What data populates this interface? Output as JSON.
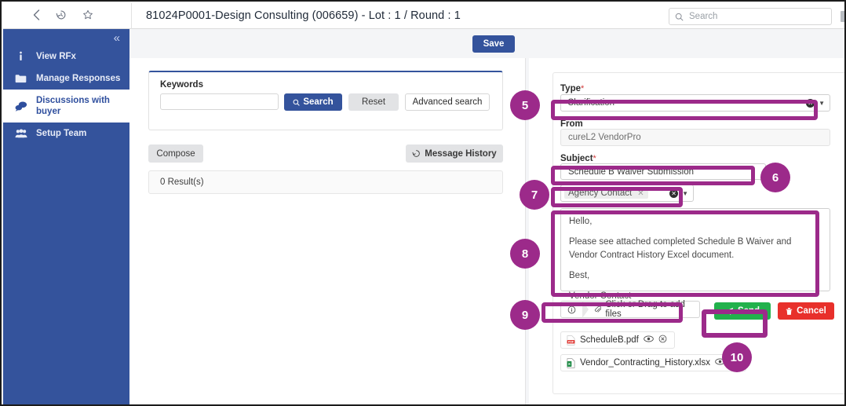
{
  "window": {
    "title": "81024P0001-Design Consulting (006659) - Lot : 1 / Round : 1",
    "nav": {
      "back": "‹",
      "history": "history-icon",
      "favorite": "star-icon"
    },
    "search": {
      "placeholder": "Search",
      "icon": "search-icon"
    }
  },
  "sidebar": {
    "collapse": "«",
    "items": [
      {
        "label": "View RFx",
        "icon": "info-icon",
        "active": false
      },
      {
        "label": "Manage Responses",
        "icon": "folder-icon",
        "active": false
      },
      {
        "label": "Discussions with buyer",
        "icon": "chat-bubbles-icon",
        "active": true
      },
      {
        "label": "Setup Team",
        "icon": "users-icon",
        "active": false
      }
    ]
  },
  "actionbar": {
    "save_label": "Save"
  },
  "search_panel": {
    "keywords_label": "Keywords",
    "keywords_value": "",
    "search_label": "Search",
    "reset_label": "Reset",
    "advanced_label": "Advanced search",
    "compose_label": "Compose",
    "message_history_label": "Message History",
    "results_label": "0 Result(s)"
  },
  "form": {
    "type_label": "Type",
    "type_required": "*",
    "type_value": "Clarification",
    "from_label": "From",
    "from_value": "cureL2 VendorPro",
    "subject_label": "Subject",
    "subject_required": "*",
    "subject_value": "Schedule B Waiver Submission",
    "recipient_chip": "Agency Contact",
    "recipient_remove": "✕",
    "body": [
      "Hello,",
      "Please see attached completed Schedule B Waiver and Vendor Contract History Excel document.",
      "Best,",
      "Vendor Contact"
    ],
    "upload_label": "Click or Drag to add files",
    "send_label": "Send",
    "cancel_label": "Cancel",
    "attachments": [
      {
        "name": "ScheduleB.pdf",
        "kind": "pdf"
      },
      {
        "name": "Vendor_Contracting_History.xlsx",
        "kind": "xlsx"
      }
    ]
  },
  "annotations": {
    "accent": "#9c2a8a",
    "steps": [
      {
        "n": "5"
      },
      {
        "n": "6"
      },
      {
        "n": "7"
      },
      {
        "n": "8"
      },
      {
        "n": "9"
      },
      {
        "n": "10"
      }
    ]
  }
}
